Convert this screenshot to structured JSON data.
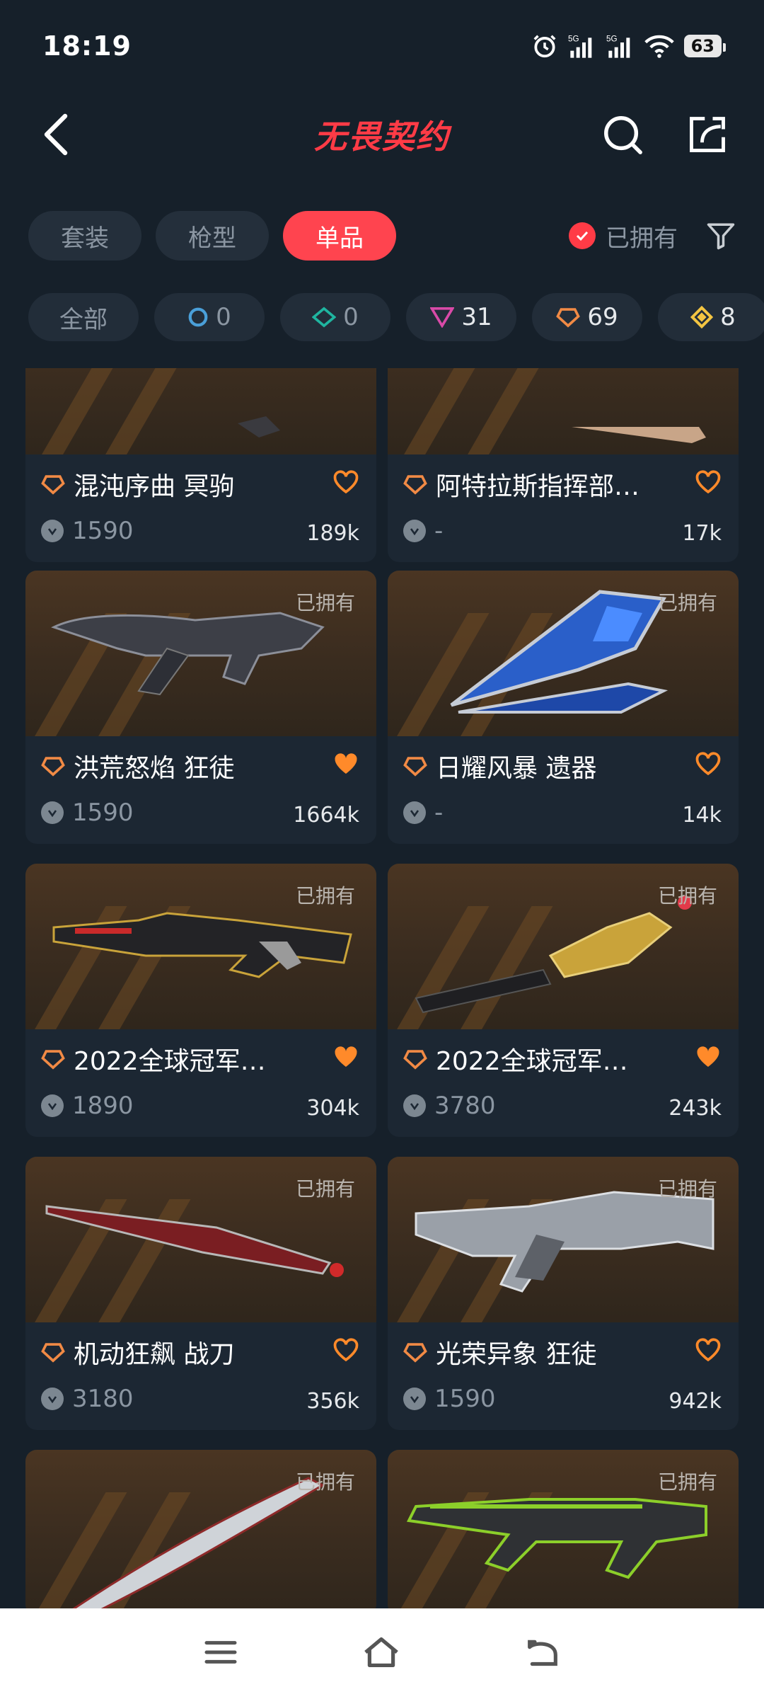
{
  "status": {
    "time": "18:19",
    "battery": "63",
    "signal1": "5G",
    "signal2": "5G"
  },
  "header": {
    "title": "无畏契约"
  },
  "tabs": [
    {
      "label": "套装",
      "active": false
    },
    {
      "label": "枪型",
      "active": false
    },
    {
      "label": "单品",
      "active": true
    }
  ],
  "owned_filter": {
    "label": "已拥有"
  },
  "chips": [
    {
      "label": "全部",
      "count": ""
    },
    {
      "label": "",
      "count": "0",
      "icon": "select-tier-icon"
    },
    {
      "label": "",
      "count": "0",
      "icon": "deluxe-tier-icon"
    },
    {
      "label": "",
      "count": "31",
      "icon": "premium-tier-icon"
    },
    {
      "label": "",
      "count": "69",
      "icon": "exclusive-tier-icon"
    },
    {
      "label": "",
      "count": "8",
      "icon": "ultra-tier-icon"
    }
  ],
  "items": [
    {
      "name": "混沌序曲 冥驹",
      "price": "1590",
      "likes": "189k",
      "owned": "",
      "favorited": false
    },
    {
      "name": "阿特拉斯指挥部…",
      "price": "-",
      "likes": "17k",
      "owned": "",
      "favorited": false
    },
    {
      "name": "洪荒怒焰 狂徒",
      "price": "1590",
      "likes": "1664k",
      "owned": "已拥有",
      "favorited": true
    },
    {
      "name": "日耀风暴 遗器",
      "price": "-",
      "likes": "14k",
      "owned": "已拥有",
      "favorited": false
    },
    {
      "name": "2022全球冠军…",
      "price": "1890",
      "likes": "304k",
      "owned": "已拥有",
      "favorited": true
    },
    {
      "name": "2022全球冠军…",
      "price": "3780",
      "likes": "243k",
      "owned": "已拥有",
      "favorited": true
    },
    {
      "name": "机动狂飙 战刀",
      "price": "3180",
      "likes": "356k",
      "owned": "已拥有",
      "favorited": false
    },
    {
      "name": "光荣异象 狂徒",
      "price": "1590",
      "likes": "942k",
      "owned": "已拥有",
      "favorited": false
    },
    {
      "name": "",
      "price": "",
      "likes": "",
      "owned": "已拥有",
      "favorited": false
    },
    {
      "name": "",
      "price": "",
      "likes": "",
      "owned": "已拥有",
      "favorited": false
    }
  ],
  "colors": {
    "accent": "#ff3b46",
    "heart": "#ff8a2a",
    "background": "#16202a",
    "card": "#1c2733"
  }
}
